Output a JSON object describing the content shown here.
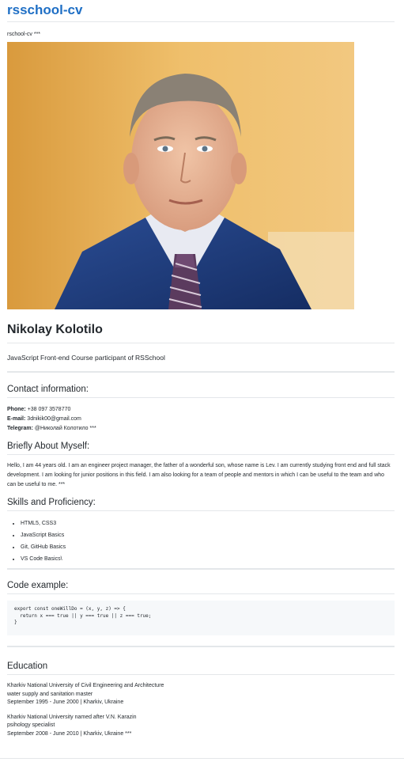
{
  "site": {
    "title": "rsschool-cv",
    "tagline": "rschool-cv ***"
  },
  "profile": {
    "name": "Nikolay Kolotilo",
    "lead": "JavaScript Front-end Course participant of RSSchool"
  },
  "contact": {
    "heading": "Contact information:",
    "phone_label": "Phone:",
    "phone": "+38 097 3578770",
    "email_label": "E-mail:",
    "email": "3dnikik00@gmail.com",
    "telegram_label": "Telegram:",
    "telegram": "@Николай Колотило ***"
  },
  "about": {
    "heading": "Briefly About Myself:",
    "text": "Hello, I am 44 years old. I am an engineer project manager, the father of a wonderful son, whose name is Lev. I am currently studying front end and full stack development. I am looking for junior positions in this field. I am also looking for a team of people and mentors in which I can be useful to the team and who can be useful to me. ***"
  },
  "skills": {
    "heading": "Skills and Proficiency:",
    "items": [
      "HTML5, CSS3",
      "JavaScript Basics",
      "Git, GitHub Basics",
      "VS Code Basics\\"
    ]
  },
  "code": {
    "heading": "Code example:",
    "lines": [
      "export const oneWillDo = (x, y, z) => {",
      "  return x === true || y === true || z === true;",
      "}"
    ]
  },
  "education": {
    "heading": "Education",
    "entries": [
      {
        "school": "Kharkiv National University of Civil Engineering and Architecture",
        "degree": "water supply and sanitation master",
        "period": "September 1995 - June 2000 | Kharkiv, Ukraine"
      },
      {
        "school": "Kharkiv National University named after V.N. Karazin",
        "degree": "psihology specialist",
        "period": "September 2008 - June 2010 | Kharkiv, Ukraine ***"
      }
    ]
  },
  "colors": {
    "link": "#1f6fc5",
    "text": "#24292e",
    "divider": "#e4e7ea",
    "code_bg": "#f6f8fa",
    "photo_bg": "#e9b25a",
    "suit": "#1d3c7c"
  },
  "photo": {
    "icon": "portrait-photo"
  }
}
